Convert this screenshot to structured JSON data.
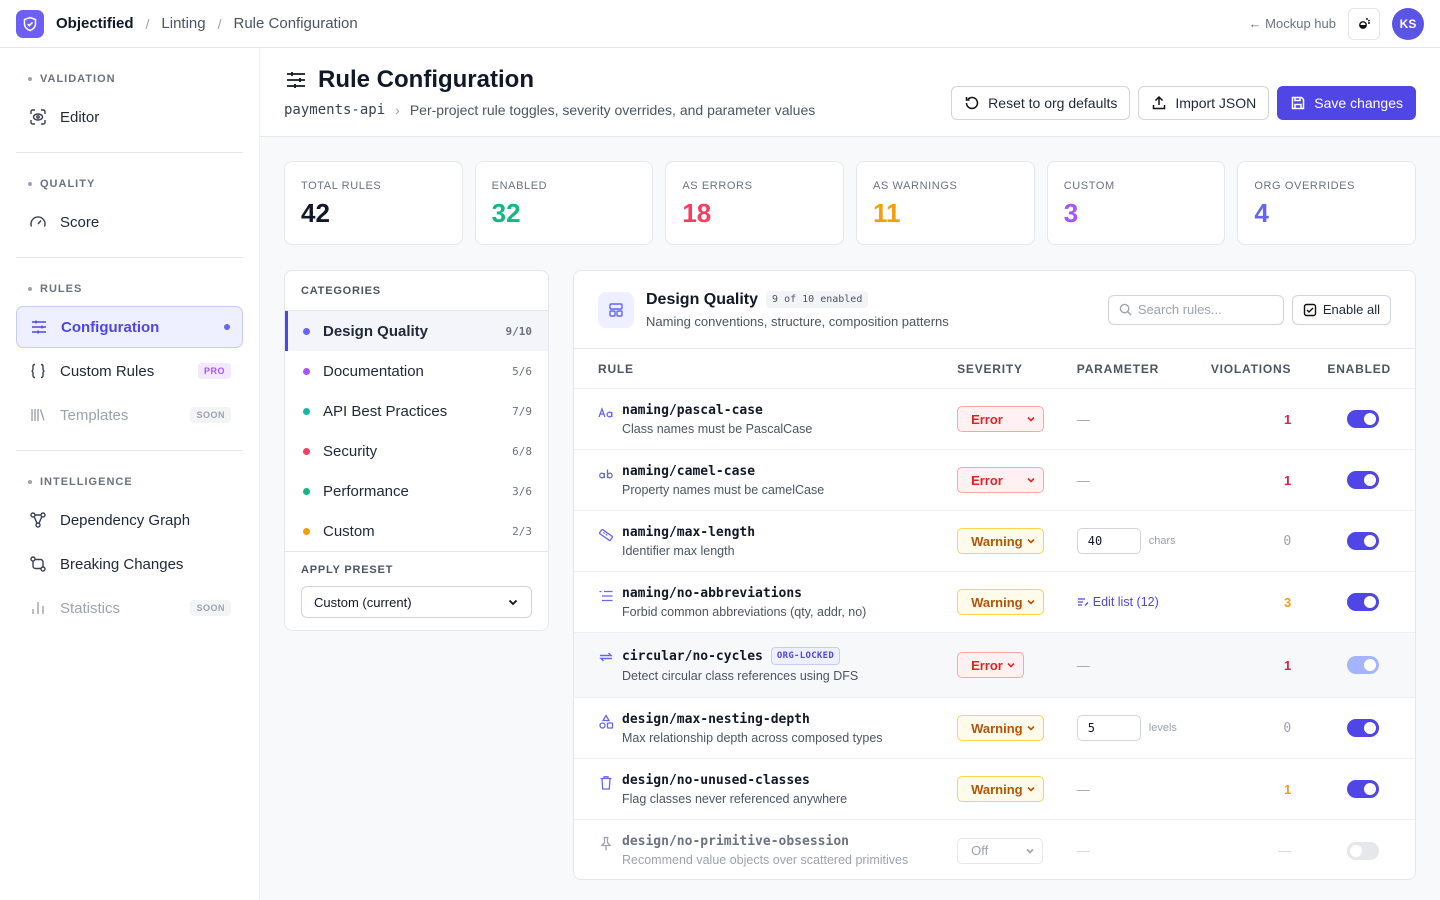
{
  "app": {
    "brand": "Objectified",
    "breadcrumbs": [
      "Linting",
      "Rule Configuration"
    ]
  },
  "topbar": {
    "mockup_link": "← Mockup hub",
    "avatar_initials": "KS"
  },
  "sidebar": {
    "sections": [
      {
        "title": "VALIDATION",
        "items": [
          {
            "label": "Editor",
            "icon": "eye-scan-icon"
          }
        ]
      },
      {
        "title": "QUALITY",
        "items": [
          {
            "label": "Score",
            "icon": "gauge-icon"
          }
        ]
      },
      {
        "title": "RULES",
        "items": [
          {
            "label": "Configuration",
            "icon": "sliders-icon",
            "active": true
          },
          {
            "label": "Custom Rules",
            "icon": "braces-icon",
            "badge": "PRO"
          },
          {
            "label": "Templates",
            "icon": "library-icon",
            "badge": "SOON",
            "disabled": true
          }
        ]
      },
      {
        "title": "INTELLIGENCE",
        "items": [
          {
            "label": "Dependency Graph",
            "icon": "graph-icon"
          },
          {
            "label": "Breaking Changes",
            "icon": "git-compare-icon"
          },
          {
            "label": "Statistics",
            "icon": "bar-chart-icon",
            "badge": "SOON",
            "disabled": true
          }
        ]
      }
    ]
  },
  "header": {
    "title": "Rule Configuration",
    "project": "payments-api",
    "subtitle": "Per-project rule toggles, severity overrides, and parameter values",
    "reset_label": "Reset to org defaults",
    "import_label": "Import JSON",
    "save_label": "Save changes"
  },
  "stats": [
    {
      "label": "TOTAL RULES",
      "value": "42",
      "color": "#111827"
    },
    {
      "label": "ENABLED",
      "value": "32",
      "color": "#10b981"
    },
    {
      "label": "AS ERRORS",
      "value": "18",
      "color": "#f43f5e"
    },
    {
      "label": "AS WARNINGS",
      "value": "11",
      "color": "#f59e0b"
    },
    {
      "label": "CUSTOM",
      "value": "3",
      "color": "#a855f7"
    },
    {
      "label": "ORG OVERRIDES",
      "value": "4",
      "color": "#6366f1"
    }
  ],
  "categories": {
    "title": "CATEGORIES",
    "items": [
      {
        "label": "Design Quality",
        "count": "9/10",
        "color": "#6366f1",
        "active": true
      },
      {
        "label": "Documentation",
        "count": "5/6",
        "color": "#a855f7"
      },
      {
        "label": "API Best Practices",
        "count": "7/9",
        "color": "#14b8a6"
      },
      {
        "label": "Security",
        "count": "6/8",
        "color": "#f43f5e"
      },
      {
        "label": "Performance",
        "count": "3/6",
        "color": "#10b981"
      },
      {
        "label": "Custom",
        "count": "2/3",
        "color": "#f59e0b"
      }
    ],
    "preset_title": "APPLY PRESET",
    "preset_value": "Custom (current)"
  },
  "rules_panel": {
    "title": "Design Quality",
    "pill": "9 of 10 enabled",
    "subtitle": "Naming conventions, structure, composition patterns",
    "search_placeholder": "Search rules...",
    "enable_all_label": "Enable all",
    "columns": {
      "rule": "RULE",
      "severity": "SEVERITY",
      "parameter": "PARAMETER",
      "violations": "VIOLATIONS",
      "enabled": "ENABLED"
    },
    "rows": [
      {
        "icon": "text-case-icon",
        "name": "naming/pascal-case",
        "desc": "Class names must be PascalCase",
        "severity": "Error",
        "param": "—",
        "violations": "1",
        "vio_color": "#e11d48",
        "toggle": "on"
      },
      {
        "icon": "text-lowercase-icon",
        "name": "naming/camel-case",
        "desc": "Property names must be camelCase",
        "severity": "Error",
        "param": "—",
        "violations": "1",
        "vio_color": "#e11d48",
        "toggle": "on"
      },
      {
        "icon": "ruler-icon",
        "name": "naming/max-length",
        "desc": "Identifier max length",
        "severity": "Warning",
        "param_input": "40",
        "param_unit": "chars",
        "violations": "0",
        "vio_color": "#9ca3af",
        "toggle": "on"
      },
      {
        "icon": "list-icon",
        "name": "naming/no-abbreviations",
        "desc": "Forbid common abbreviations (qty, addr, no)",
        "severity": "Warning",
        "param_link": "Edit list (12)",
        "violations": "3",
        "vio_color": "#f59e0b",
        "toggle": "on"
      },
      {
        "icon": "cycle-arrows-icon",
        "name": "circular/no-cycles",
        "badge": "ORG-LOCKED",
        "desc": "Detect circular class references using DFS",
        "severity": "Error",
        "param": "—",
        "violations": "1",
        "vio_color": "#e11d48",
        "toggle": "dim"
      },
      {
        "icon": "shapes-icon",
        "name": "design/max-nesting-depth",
        "desc": "Max relationship depth across composed types",
        "severity": "Warning",
        "param_input": "5",
        "param_unit": "levels",
        "violations": "0",
        "vio_color": "#9ca3af",
        "toggle": "on"
      },
      {
        "icon": "trash-icon",
        "name": "design/no-unused-classes",
        "desc": "Flag classes never referenced anywhere",
        "severity": "Warning",
        "param": "—",
        "violations": "1",
        "vio_color": "#f59e0b",
        "toggle": "on"
      },
      {
        "icon": "pin-icon",
        "name": "design/no-primitive-obsession",
        "desc": "Recommend value objects over scattered primitives",
        "severity": "Off",
        "param": "—",
        "violations": "—",
        "vio_color": "#d1d5db",
        "toggle": "off"
      }
    ]
  }
}
